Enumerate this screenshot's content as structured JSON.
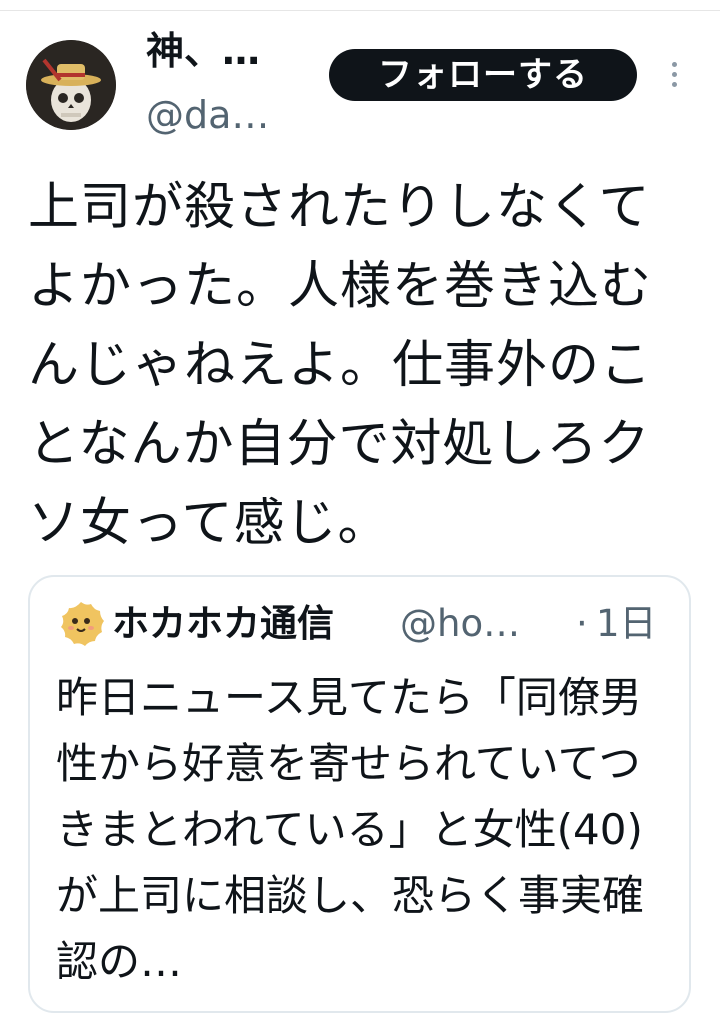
{
  "tweet": {
    "author": {
      "display_name": "神、…",
      "handle": "@da…",
      "avatar_icon": "skull-with-straw-hat-avatar"
    },
    "follow_label": "フォローする",
    "more_icon": "more-vertical-icon",
    "text": "上司が殺されたりしなくてよかった。人様を巻き込むんじゃねえよ。仕事外のことなんか自分で対処しろクソ女って感じ。"
  },
  "quote": {
    "avatar_icon": "cookie-face-avatar",
    "name": "ホカホカ通信",
    "handle": "@ho…",
    "separator": "·",
    "time": "1日",
    "text": "昨日ニュース見てたら「同僚男性から好意を寄せられていてつきまとわれている」と女性(40)が上司に相談し、恐らく事実確認の…"
  },
  "colors": {
    "text": "#0f1419",
    "muted": "#536471",
    "button_bg": "#0f1419",
    "button_text": "#ffffff",
    "border": "#e1e8ed"
  }
}
